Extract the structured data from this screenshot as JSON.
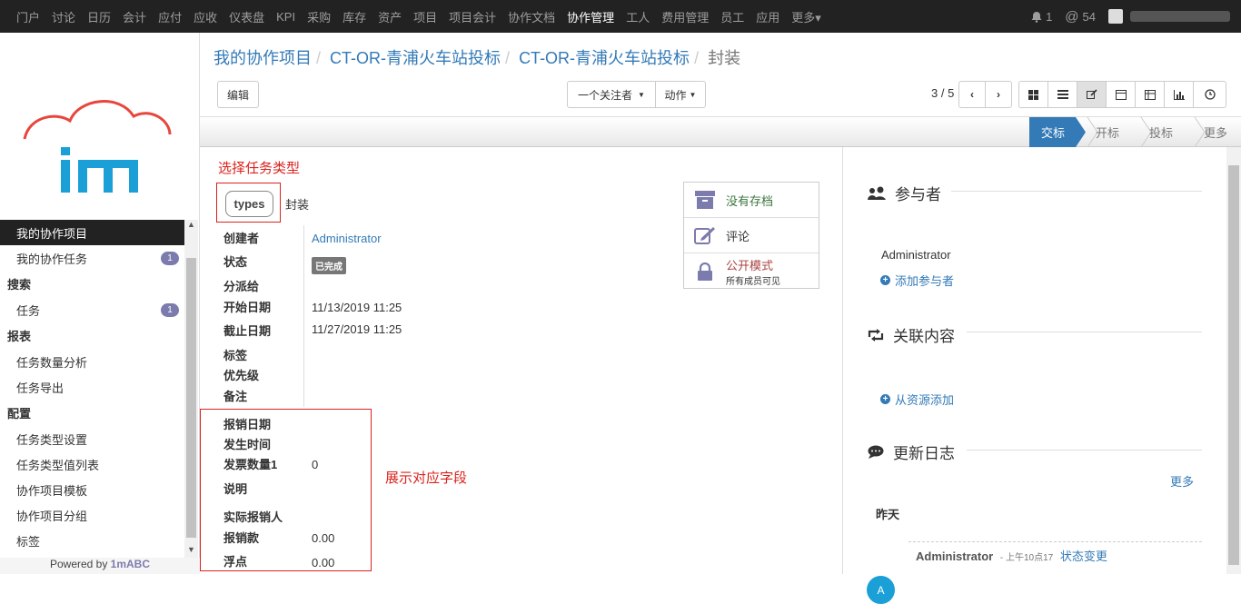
{
  "topnav": {
    "items": [
      "门户",
      "讨论",
      "日历",
      "会计",
      "应付",
      "应收",
      "仪表盘",
      "KPI",
      "采购",
      "库存",
      "资产",
      "项目",
      "项目会计",
      "协作文档",
      "协作管理",
      "工人",
      "费用管理",
      "员工",
      "应用",
      "更多▾"
    ],
    "active_index": 14,
    "notifications": "1",
    "mentions": "54"
  },
  "sidebar": {
    "items": [
      {
        "label": "我的协作项目",
        "type": "item",
        "selected": true
      },
      {
        "label": "我的协作任务",
        "type": "item",
        "badge": "1"
      },
      {
        "label": "搜索",
        "type": "section"
      },
      {
        "label": "任务",
        "type": "item",
        "badge": "1"
      },
      {
        "label": "报表",
        "type": "section"
      },
      {
        "label": "任务数量分析",
        "type": "item"
      },
      {
        "label": "任务导出",
        "type": "item"
      },
      {
        "label": "配置",
        "type": "section"
      },
      {
        "label": "任务类型设置",
        "type": "item"
      },
      {
        "label": "任务类型值列表",
        "type": "item"
      },
      {
        "label": "协作项目模板",
        "type": "item"
      },
      {
        "label": "协作项目分组",
        "type": "item"
      },
      {
        "label": "标签",
        "type": "item"
      }
    ],
    "powered_prefix": "Powered by ",
    "powered_brand": "1mABC"
  },
  "breadcrumb": {
    "parts": [
      "我的协作项目",
      "CT-OR-青浦火车站投标",
      "CT-OR-青浦火车站投标"
    ],
    "current": "封装"
  },
  "toolbar": {
    "edit": "编辑",
    "followers": "一个关注者",
    "action": "动作",
    "pager": "3 / 5"
  },
  "stages": [
    "交标",
    "开标",
    "投标",
    "更多"
  ],
  "form": {
    "annotation_type": "选择任务类型",
    "annotation_fields": "展示对应字段",
    "type_pill": "types",
    "type_value": "封装",
    "fields": [
      {
        "label": "创建者",
        "value": "Administrator"
      },
      {
        "label": "状态",
        "value": "已完成"
      },
      {
        "label": "分派给",
        "value": ""
      },
      {
        "label": "开始日期",
        "value": "11/13/2019 11:25"
      },
      {
        "label": "截止日期",
        "value": "11/27/2019 11:25"
      },
      {
        "label": "标签",
        "value": ""
      },
      {
        "label": "优先级",
        "value": ""
      },
      {
        "label": "备注",
        "value": ""
      },
      {
        "label": "报销日期",
        "value": ""
      },
      {
        "label": "发生时间",
        "value": ""
      },
      {
        "label": "发票数量1",
        "value": "0"
      },
      {
        "label": "说明",
        "value": ""
      },
      {
        "label": "实际报销人",
        "value": ""
      },
      {
        "label": "报销款",
        "value": "0.00"
      },
      {
        "label": "浮点",
        "value": "0.00"
      }
    ],
    "stat_archive": "没有存档",
    "stat_comment": "评论",
    "stat_public": "公开模式",
    "stat_public_sub": "所有成员可见"
  },
  "chatter": {
    "participants_title": "参与者",
    "participant": "Administrator",
    "add_participant": "添加参与者",
    "related_title": "关联内容",
    "add_from_resource": "从资源添加",
    "log_title": "更新日志",
    "more": "更多",
    "yesterday": "昨天",
    "log_author": "Administrator",
    "log_time": "- 上午10点17",
    "log_action": "状态变更",
    "avatar_letter": "A"
  },
  "colors": {
    "topbar": "#222222",
    "link": "#337ab7",
    "annotation": "#d9231d",
    "badge": "#7c7bad"
  }
}
